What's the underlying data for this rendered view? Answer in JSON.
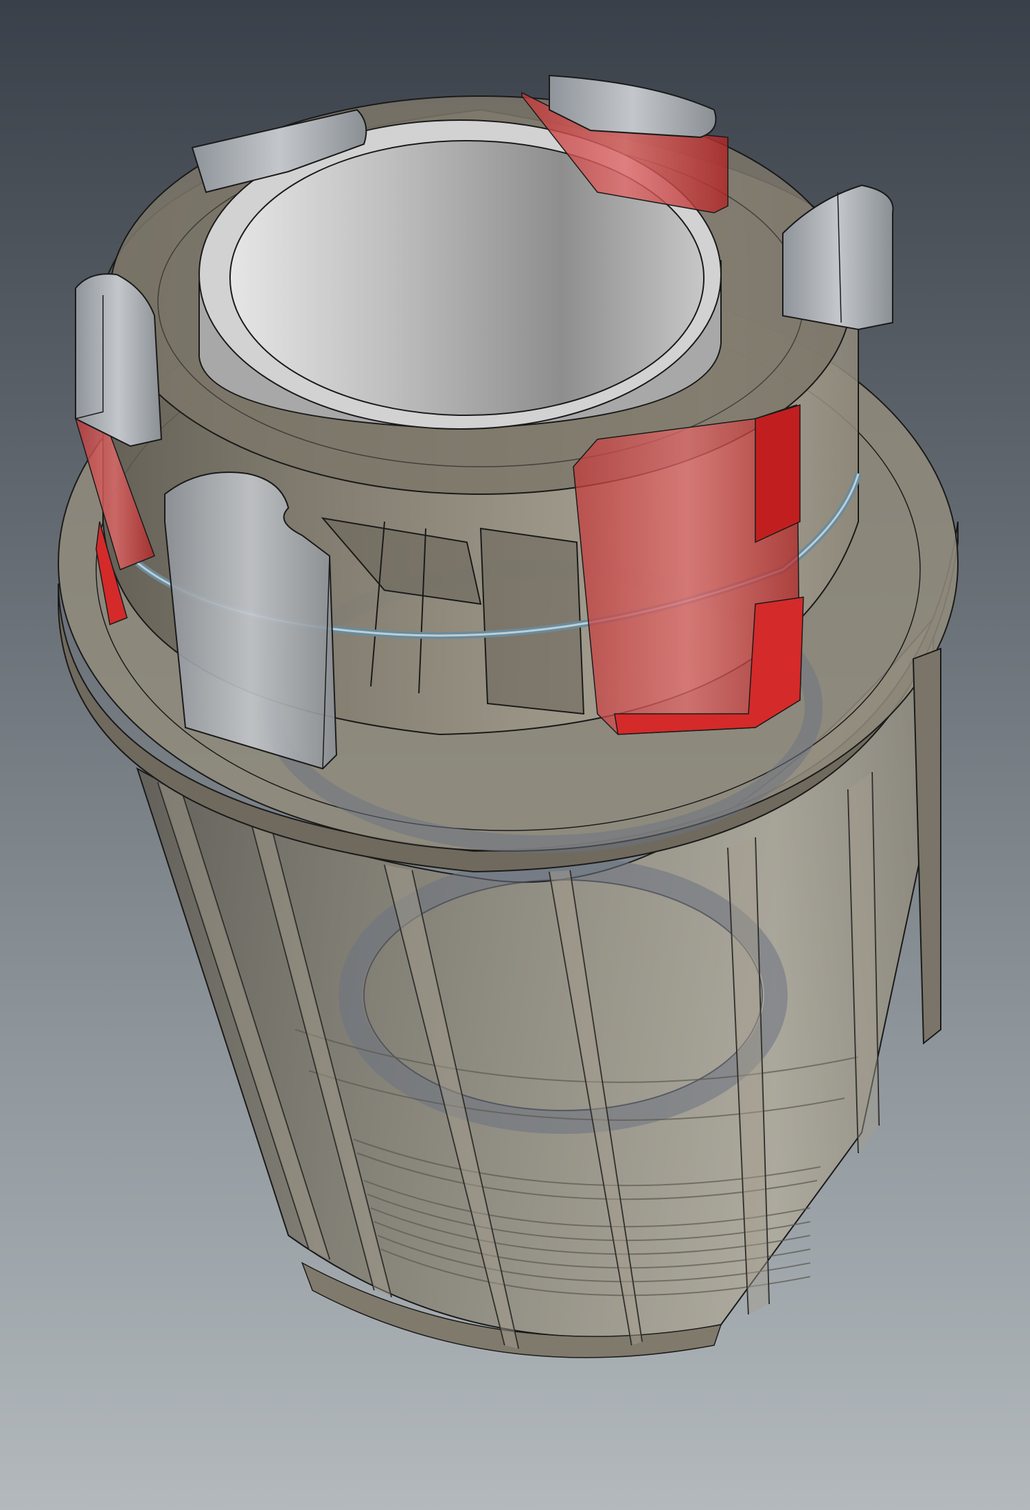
{
  "viewport": {
    "background_top": "#3a4049",
    "background_bottom": "#b3b9bd"
  },
  "model": {
    "part": "freehub-body",
    "body_color": "#8b8577",
    "body_opacity": 0.78,
    "bore_color": "#c9c9c9",
    "pawl_color": "#b9bec2",
    "highlight_color": "#d42a2a",
    "spring_ring_color": "#6d8a98",
    "bearing_color": "#6c7282",
    "edge_color": "#1a1a1a"
  }
}
